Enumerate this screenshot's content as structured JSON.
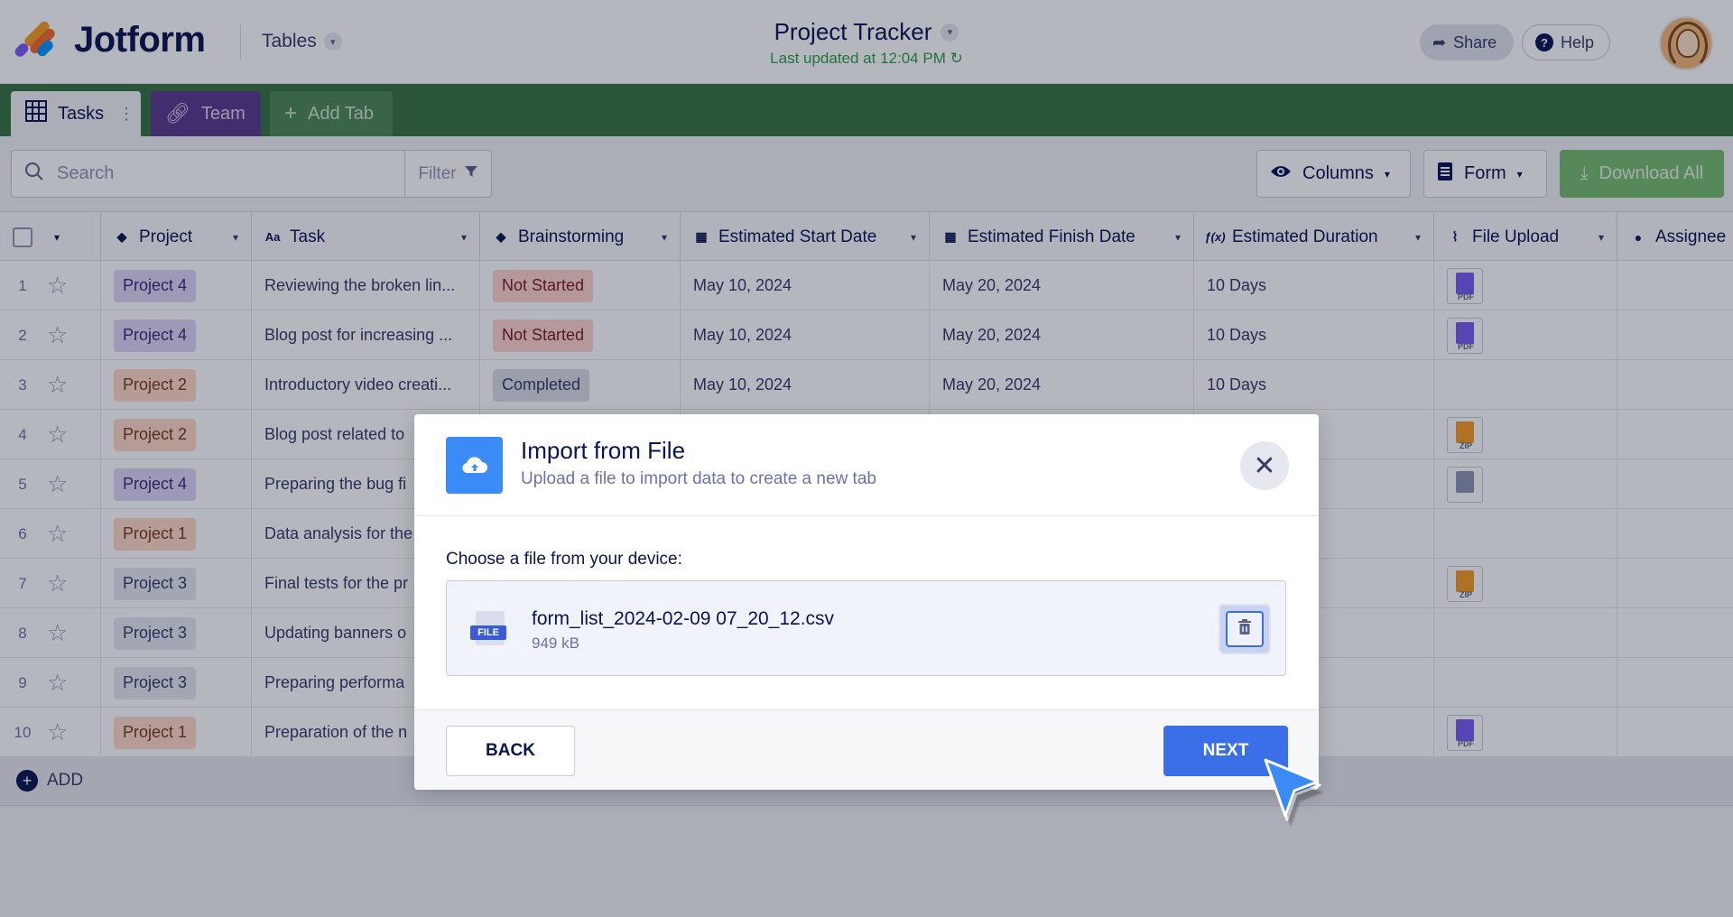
{
  "brand": {
    "name": "Jotform"
  },
  "header": {
    "product_label": "Tables",
    "doc_title": "Project Tracker",
    "last_updated": "Last updated at 12:04 PM",
    "share_label": "Share",
    "help_label": "Help"
  },
  "tabs": [
    {
      "label": "Tasks"
    },
    {
      "label": "Team"
    },
    {
      "label": "Add Tab"
    }
  ],
  "toolbar": {
    "search_placeholder": "Search",
    "filter_label": "Filter",
    "columns_label": "Columns",
    "form_label": "Form",
    "download_label": "Download All"
  },
  "table": {
    "columns": [
      {
        "label": "Project",
        "icon": "tag-icon"
      },
      {
        "label": "Task",
        "icon": "text-icon"
      },
      {
        "label": "Brainstorming",
        "icon": "tag-icon"
      },
      {
        "label": "Estimated Start Date",
        "icon": "calendar-icon"
      },
      {
        "label": "Estimated Finish Date",
        "icon": "calendar-icon"
      },
      {
        "label": "Estimated Duration",
        "icon": "formula-icon"
      },
      {
        "label": "File Upload",
        "icon": "paperclip-icon"
      },
      {
        "label": "Assignee",
        "icon": "person-icon"
      }
    ],
    "rows": [
      {
        "n": "1",
        "project": "Project 4",
        "task": "Reviewing the broken lin...",
        "status": "Not Started",
        "start": "May 10, 2024",
        "finish": "May 20, 2024",
        "duration": "10 Days",
        "file": "PDF"
      },
      {
        "n": "2",
        "project": "Project 4",
        "task": "Blog post for increasing ...",
        "status": "Not Started",
        "start": "May 10, 2024",
        "finish": "May 20, 2024",
        "duration": "10 Days",
        "file": "PDF"
      },
      {
        "n": "3",
        "project": "Project 2",
        "task": "Introductory video creati...",
        "status": "Completed",
        "start": "May 10, 2024",
        "finish": "May 20, 2024",
        "duration": "10 Days",
        "file": ""
      },
      {
        "n": "4",
        "project": "Project 2",
        "task": "Blog post related to",
        "status": "",
        "start": "",
        "finish": "",
        "duration": "",
        "file": "ZIP"
      },
      {
        "n": "5",
        "project": "Project 4",
        "task": "Preparing the bug fi",
        "status": "",
        "start": "",
        "finish": "",
        "duration": "",
        "file": "IMG"
      },
      {
        "n": "6",
        "project": "Project 1",
        "task": "Data analysis for the",
        "status": "",
        "start": "",
        "finish": "",
        "duration": "",
        "file": ""
      },
      {
        "n": "7",
        "project": "Project 3",
        "task": "Final tests for the pr",
        "status": "",
        "start": "",
        "finish": "",
        "duration": "",
        "file": "ZIP"
      },
      {
        "n": "8",
        "project": "Project 3",
        "task": "Updating banners o",
        "status": "",
        "start": "",
        "finish": "",
        "duration": "",
        "file": ""
      },
      {
        "n": "9",
        "project": "Project 3",
        "task": "Preparing performa",
        "status": "",
        "start": "",
        "finish": "",
        "duration": "",
        "file": ""
      },
      {
        "n": "10",
        "project": "Project 1",
        "task": "Preparation of the n",
        "status": "",
        "start": "",
        "finish": "",
        "duration": "",
        "file": "PDF"
      }
    ],
    "add_label": "ADD"
  },
  "project_colors": {
    "Project 1": {
      "bg": "#ffd8c6",
      "fg": "#7a3a1f"
    },
    "Project 2": {
      "bg": "#ffd8c6",
      "fg": "#7a3a1f"
    },
    "Project 3": {
      "bg": "#e6e8ef",
      "fg": "#343c6a"
    },
    "Project 4": {
      "bg": "#ddd6f5",
      "fg": "#3a2a7a"
    }
  },
  "status_colors": {
    "Not Started": {
      "bg": "#ffd3cc",
      "fg": "#7a1f1f"
    },
    "Completed": {
      "bg": "#dadde6",
      "fg": "#343c6a"
    }
  },
  "file_colors": {
    "PDF": "#7a5cf2",
    "ZIP": "#f59b25",
    "IMG": "#8f96b3"
  },
  "modal": {
    "title": "Import from File",
    "subtitle": "Upload a file to import data to create a new tab",
    "choose_label": "Choose a file from your device:",
    "file_badge": "FILE",
    "file_name": "form_list_2024-02-09 07_20_12.csv",
    "file_size": "949 kB",
    "back_label": "BACK",
    "next_label": "NEXT"
  },
  "colors": {
    "accent": "#3b6fe8",
    "tabs_bg": "#37733f",
    "team_tab": "#5b3a8d"
  }
}
